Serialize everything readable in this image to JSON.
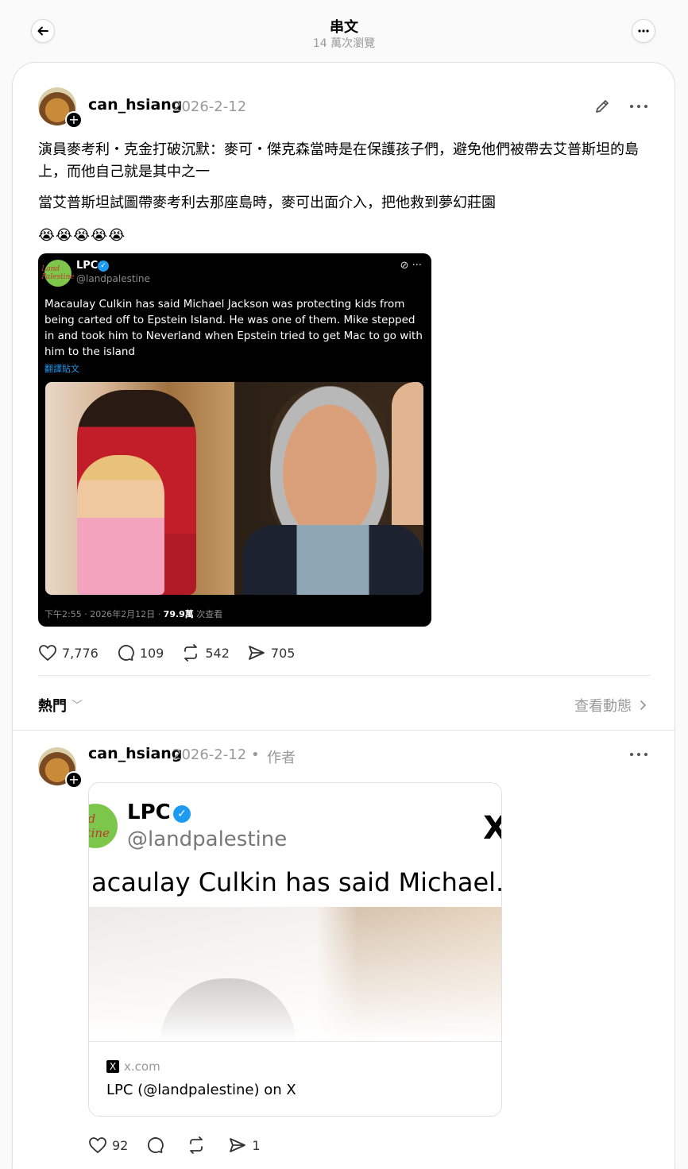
{
  "header": {
    "title": "串文",
    "views": "14 萬次瀏覽",
    "back_icon": "arrow-left-icon",
    "more_icon": "more-horizontal-icon"
  },
  "post": {
    "username": "can_hsiang",
    "date": "2026-2-12",
    "paragraph1": "演員麥考利・克金打破沉默：麥可・傑克森當時是在保護孩子們，避免他們被帶去艾普斯坦的島上，而他自己就是其中之一",
    "paragraph2": "當艾普斯坦試圖帶麥考利去那座島時，麥可出面介入，把他救到夢幻莊園",
    "emoji": "😭😭😭😭😭",
    "embedded_tweet": {
      "avatar_text": "Land Palestine",
      "name": "LPC",
      "handle": "@landpalestine",
      "text": "Macaulay Culkin has said Michael Jackson was protecting kids from being carted off to Epstein Island. He was one of them. Mike stepped in and took him to Neverland when Epstein tried to get Mac to go with him to the island",
      "translate": "翻譯貼文",
      "footer_time": "下午2:55 · 2026年2月12日 · ",
      "footer_views": "79.9萬",
      "footer_suffix": " 次查看"
    },
    "stats": {
      "likes": "7,776",
      "replies": "109",
      "reposts": "542",
      "shares": "705"
    }
  },
  "sort": {
    "label": "熱門",
    "view_activity": "查看動態"
  },
  "reply": {
    "username": "can_hsiang",
    "date": "2026-2-12",
    "dot": "•",
    "author_tag": "作者",
    "link_card": {
      "avatar_text": "and estine",
      "name": "LPC",
      "handle": "@landpalestine",
      "x_glyph": "X",
      "preview_text": "acaulay Culkin has said Michael...",
      "domain_icon": "X",
      "domain": "x.com",
      "title": "LPC (@landpalestine) on X"
    },
    "stats": {
      "likes": "92",
      "shares": "1"
    }
  }
}
